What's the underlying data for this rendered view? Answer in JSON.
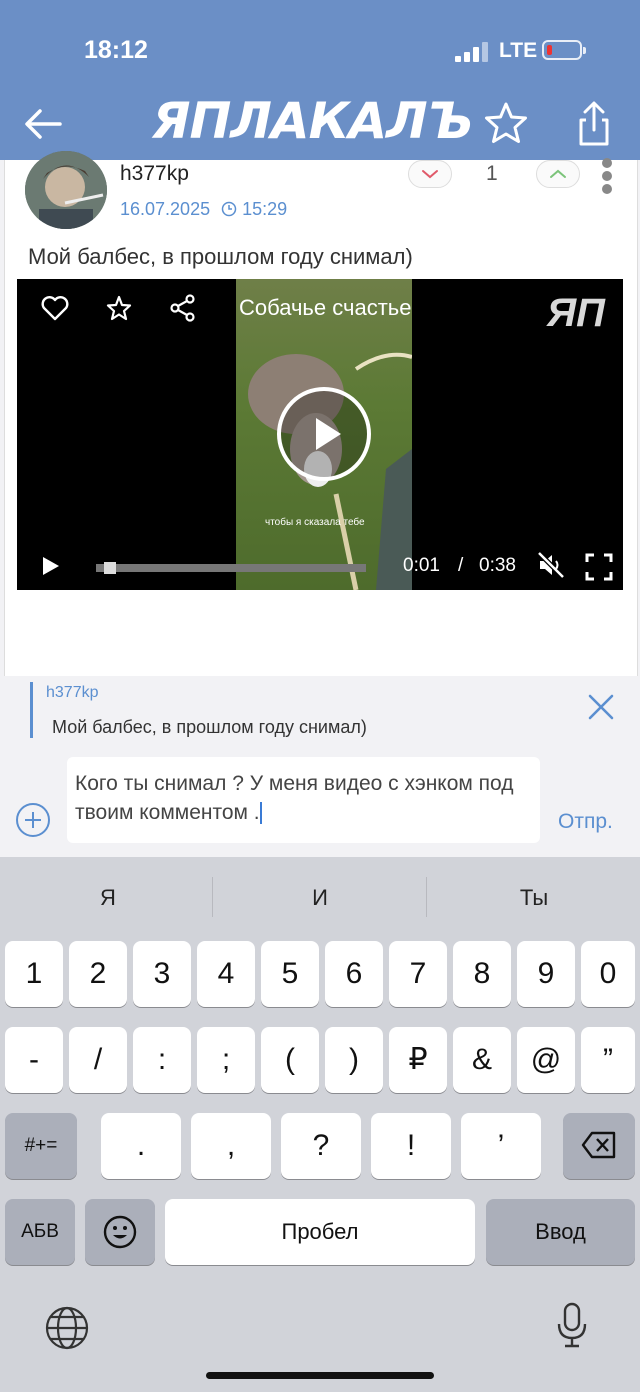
{
  "status_bar": {
    "time": "18:12",
    "network": "LTE"
  },
  "header": {
    "logo": "ЯПЛАКАЛЪ"
  },
  "post": {
    "username": "h377kp",
    "date": "16.07.2025",
    "time": "15:29",
    "score": "1",
    "text": "Мой балбес, в прошлом году снимал)"
  },
  "video": {
    "title": "Собачье счастье",
    "logo": "ЯП",
    "subtitle": "чтобы я сказала тебе",
    "current_time": "0:01",
    "separator": "/",
    "duration": "0:38",
    "progress": 0.03
  },
  "reply": {
    "quoted_user": "h377kp",
    "quoted_text": "Мой балбес, в прошлом году снимал)",
    "input_value": "Кого ты снимал ? У меня видео с хэнком под твоим комментом .",
    "send_label": "Отпр."
  },
  "keyboard": {
    "suggestions": [
      "Я",
      "И",
      "Ты"
    ],
    "row1": [
      "1",
      "2",
      "3",
      "4",
      "5",
      "6",
      "7",
      "8",
      "9",
      "0"
    ],
    "row2": [
      "-",
      "/",
      ":",
      ";",
      "(",
      ")",
      "₽",
      "&",
      "@",
      "”"
    ],
    "row3_mode": "#+=",
    "row3": [
      ".",
      ",",
      "?",
      "!",
      "’"
    ],
    "abc": "АБВ",
    "space": "Пробел",
    "enter": "Ввод"
  },
  "colors": {
    "accent": "#6b8fc6",
    "link": "#5b8fd0"
  }
}
